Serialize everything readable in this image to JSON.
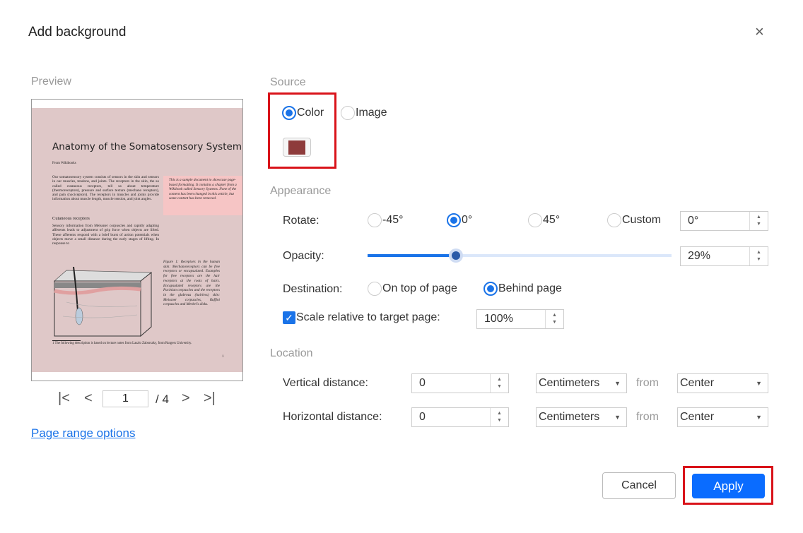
{
  "dialog": {
    "title": "Add background",
    "close": "×"
  },
  "preview": {
    "label": "Preview",
    "doc_title": "Anatomy of the Somatosensory System",
    "from": "From Wikibooks",
    "para1": "Our somatosensory system consists of sensors in the skin and sensors in our muscles, tendons, and joints. The receptors in the skin, the so called cutaneous receptors, tell us about temperature (thermoreceptors), pressure and surface texture (mechano receptors), and pain (nociceptors). The receptors in muscles and joints provide information about muscle length, muscle tension, and joint angles.",
    "note": "This is a sample document to showcase page-based formatting. It contains a chapter from a Wikibook called Sensory Systems. None of the content has been changed in this article, but some content has been removed.",
    "heading2": "Cutaneous receptors",
    "para2": "Sensory information from Meissner corpuscles and rapidly adapting afferents leads to adjustment of grip force when objects are lifted. These afferents respond with a brief burst of action potentials when objects move a small distance during the early stages of lifting. In response to",
    "caption": "Figure 1: Receptors in the human skin: Mechanoreceptors can be free receptors or encapsulated. Examples for free receptors are the hair receptors at the roots of hairs. Encapsulated receptors are the Pacinian corpuscles and the receptors in the glabrous (hairless) skin: Meissner corpuscles, Ruffini corpuscles and Merkel's disks.",
    "footnote": "1 The following description is based on lecture notes from Laszlo Zaborszky, from Rutgers University.",
    "page_no": "1",
    "current_page": "1",
    "total_pages": "/ 4",
    "page_range_link": "Page range options"
  },
  "source": {
    "label": "Source",
    "options": [
      "Color",
      "Image"
    ],
    "selected": "Color",
    "color": "#8e3b3b"
  },
  "appearance": {
    "label": "Appearance",
    "rotate_label": "Rotate:",
    "rotate_options": [
      "-45°",
      "0°",
      "45°",
      "Custom"
    ],
    "rotate_selected": "0°",
    "rotate_value": "0°",
    "opacity_label": "Opacity:",
    "opacity_value": "29%",
    "opacity_percent": 29,
    "destination_label": "Destination:",
    "destination_options": [
      "On top of page",
      "Behind page"
    ],
    "destination_selected": "Behind page",
    "scale_label": "Scale relative to target page:",
    "scale_checked": true,
    "scale_value": "100%"
  },
  "location": {
    "label": "Location",
    "vertical_label": "Vertical distance:",
    "vertical_value": "0",
    "vertical_unit": "Centimeters",
    "vertical_from": "Center",
    "horizontal_label": "Horizontal distance:",
    "horizontal_value": "0",
    "horizontal_unit": "Centimeters",
    "horizontal_from": "Center",
    "from_label": "from"
  },
  "buttons": {
    "cancel": "Cancel",
    "apply": "Apply"
  },
  "colors": {
    "accent": "#1a73e8",
    "highlight": "#d9131a",
    "preview_bg": "#dfc8c8"
  }
}
